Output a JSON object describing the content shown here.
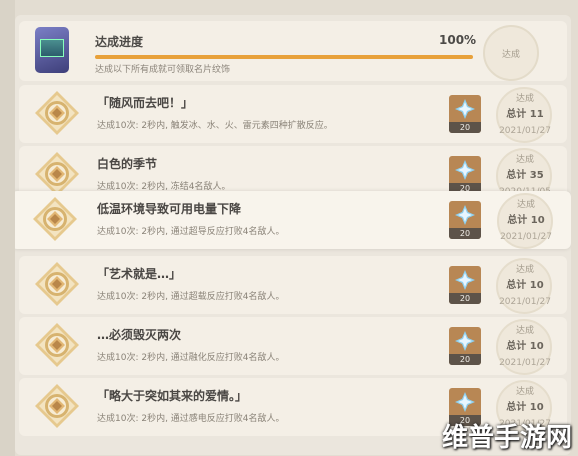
{
  "progress": {
    "title": "达成进度",
    "percent_text": "100%",
    "percent": 100,
    "description": "达成以下所有成就可领取名片纹饰",
    "seal_label": "达成"
  },
  "achievements": [
    {
      "title": "「随风而去吧！」",
      "desc": "达成10次: 2秒内, 触发冰、水、火、雷元素四种扩散反应。",
      "reward": "20",
      "seal_line1": "达成",
      "seal_line2": "总计 11",
      "date": "2021/01/27"
    },
    {
      "title": "白色的季节",
      "desc": "达成10次: 2秒内, 冻结4名敌人。",
      "reward": "20",
      "seal_line1": "达成",
      "seal_line2": "总计 35",
      "date": "2020/11/05"
    },
    {
      "title": "低温环境导致可用电量下降",
      "desc": "达成10次: 2秒内, 通过超导反应打败4名敌人。",
      "reward": "20",
      "seal_line1": "达成",
      "seal_line2": "总计 10",
      "date": "2021/01/27"
    },
    {
      "title": "「艺术就是…」",
      "desc": "达成10次: 2秒内, 通过超载反应打败4名敌人。",
      "reward": "20",
      "seal_line1": "达成",
      "seal_line2": "总计 10",
      "date": "2021/01/27"
    },
    {
      "title": "…必须毁灭两次",
      "desc": "达成10次: 2秒内, 通过融化反应打败4名敌人。",
      "reward": "20",
      "seal_line1": "达成",
      "seal_line2": "总计 10",
      "date": "2021/01/27"
    },
    {
      "title": "「略大于突如其来的爱情。」",
      "desc": "达成10次: 2秒内, 通过感电反应打败4名敌人。",
      "reward": "20",
      "seal_line1": "达成",
      "seal_line2": "总计 10",
      "date": "2021/01/27"
    }
  ],
  "watermark": "维普手游网",
  "colors": {
    "accent": "#e8a13a",
    "reward_bg": "#b88754",
    "gem": "#7fc3e8"
  }
}
